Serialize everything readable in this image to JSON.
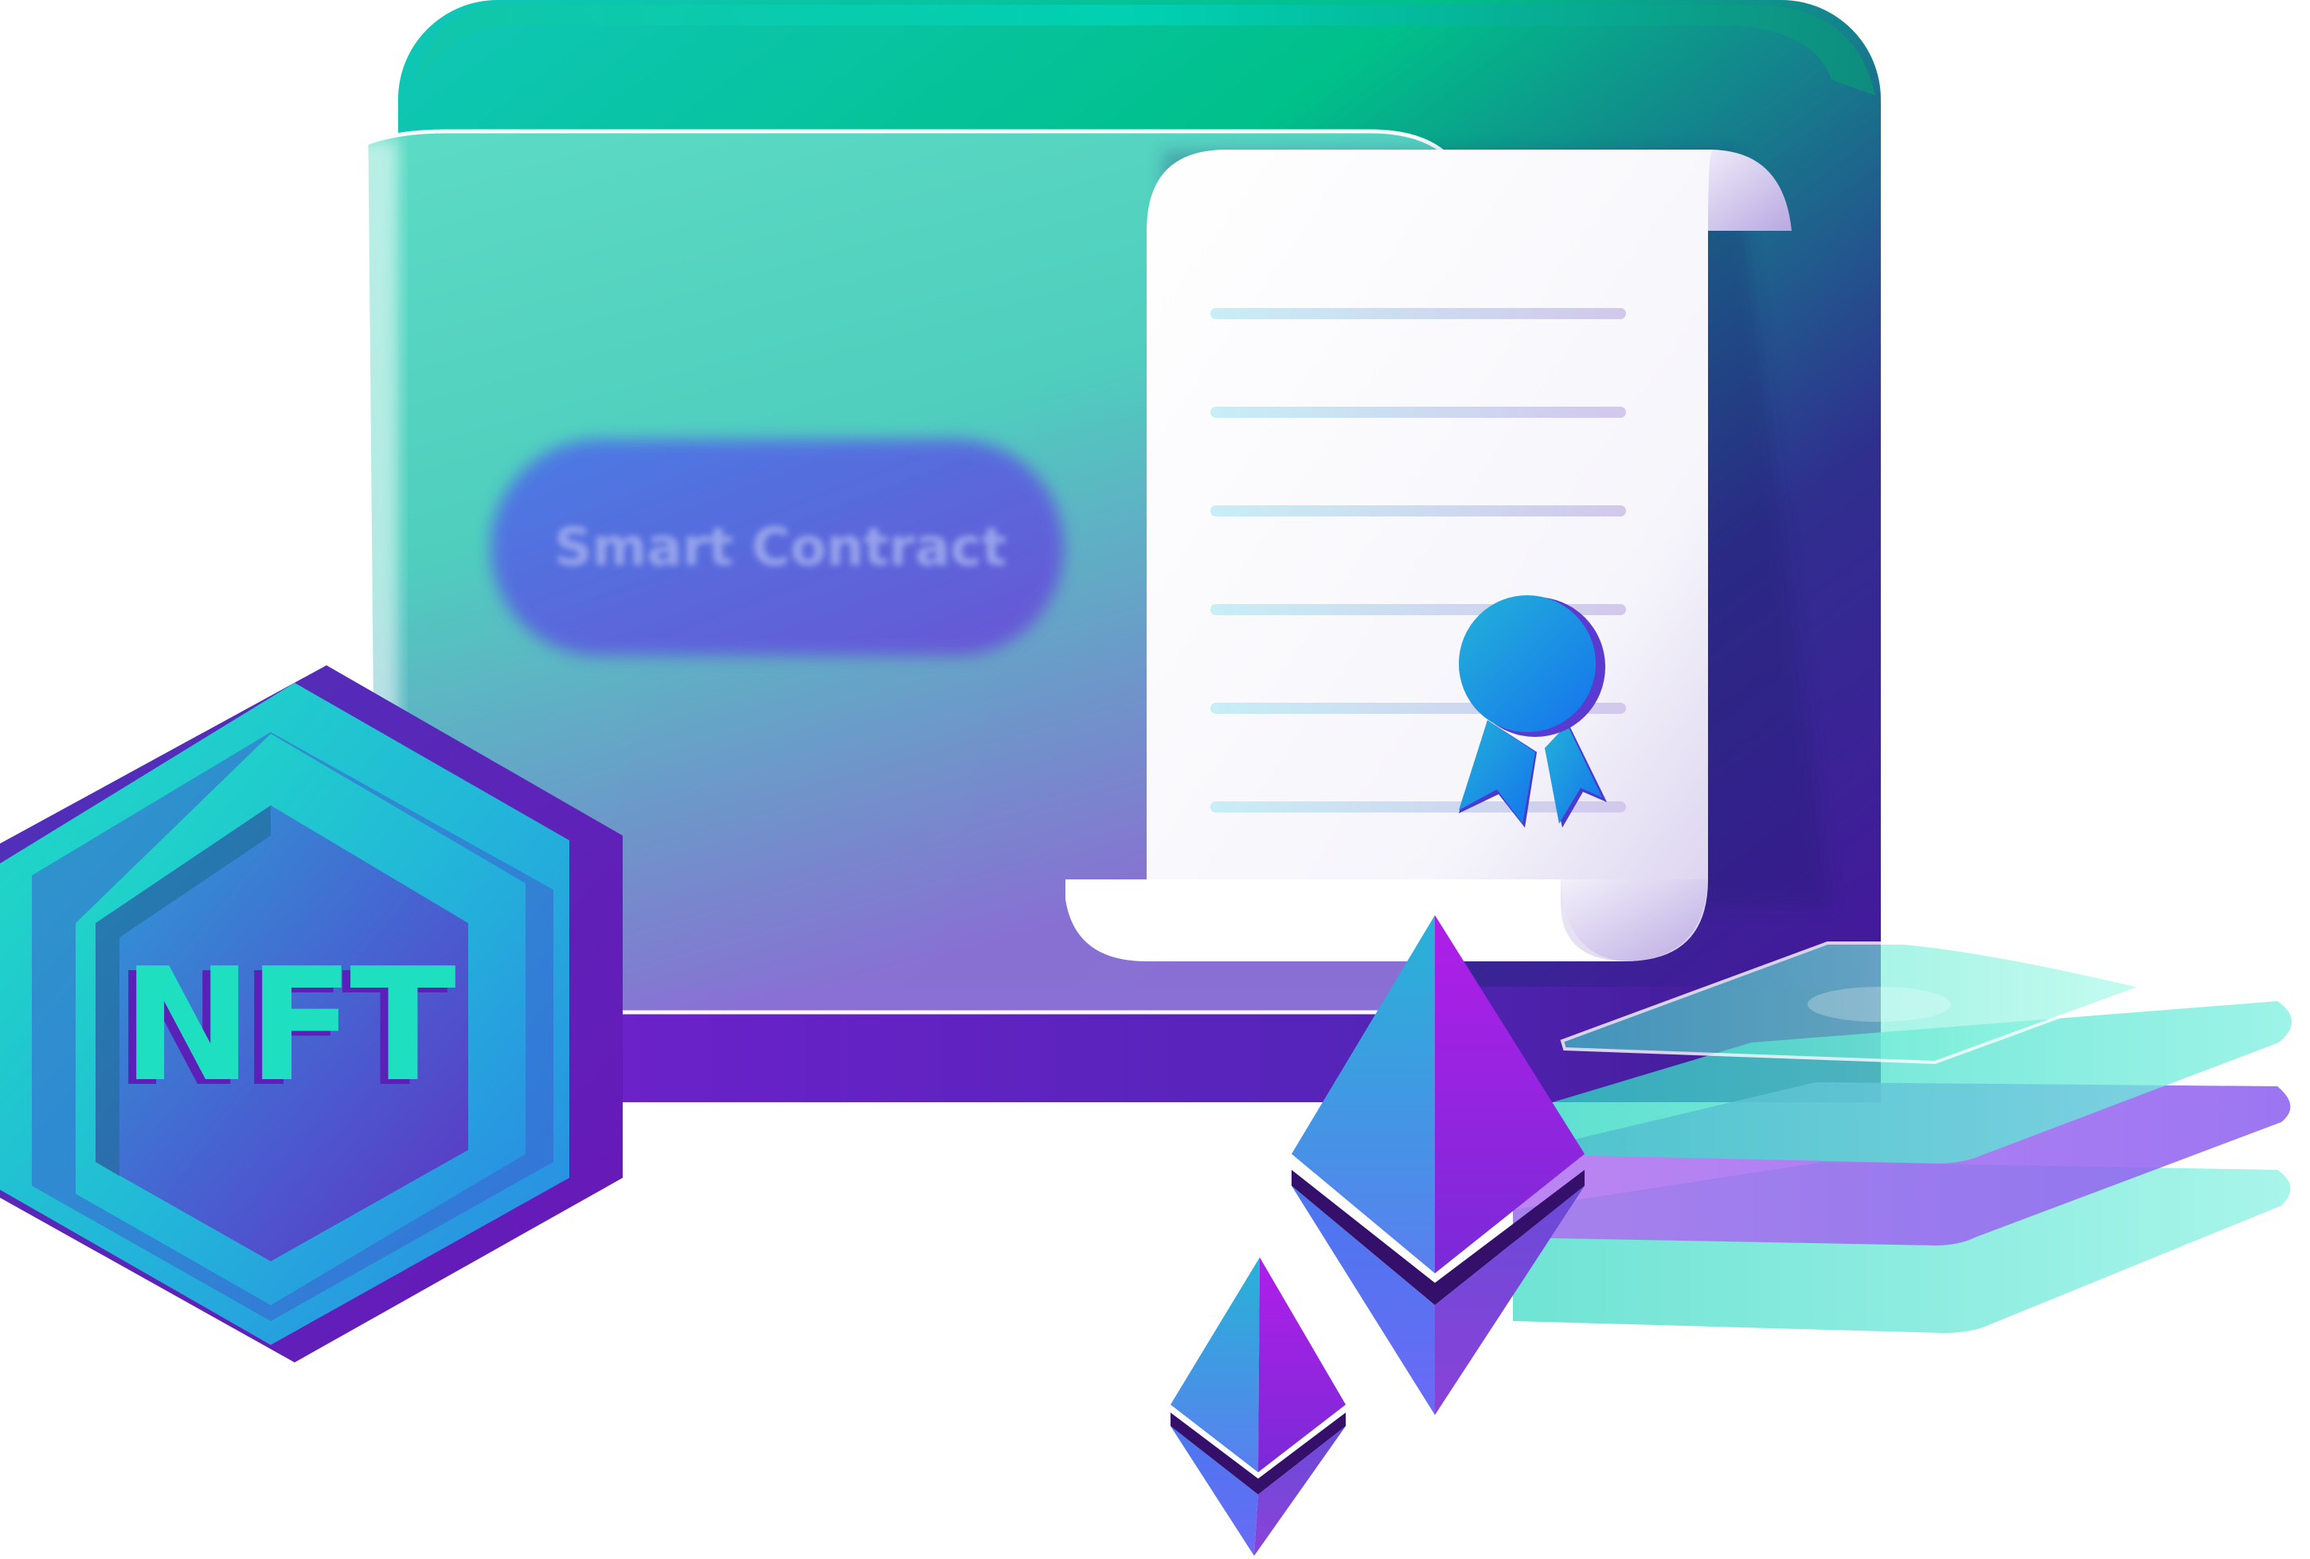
{
  "illustration": {
    "contract_button_label": "Smart Contract",
    "nft_badge_label": "NFT"
  },
  "colors": {
    "teal": "#1ed8c0",
    "green": "#00c08a",
    "purple": "#6a22c9",
    "violet": "#a02ee6",
    "blue": "#1f7ee8",
    "indigo": "#4a2fa8",
    "paper": "#ffffff"
  },
  "icons": [
    "monitor-icon",
    "certificate-icon",
    "ribbon-seal-icon",
    "nft-hexagon-icon",
    "ethereum-icon",
    "stacked-layers-icon"
  ]
}
